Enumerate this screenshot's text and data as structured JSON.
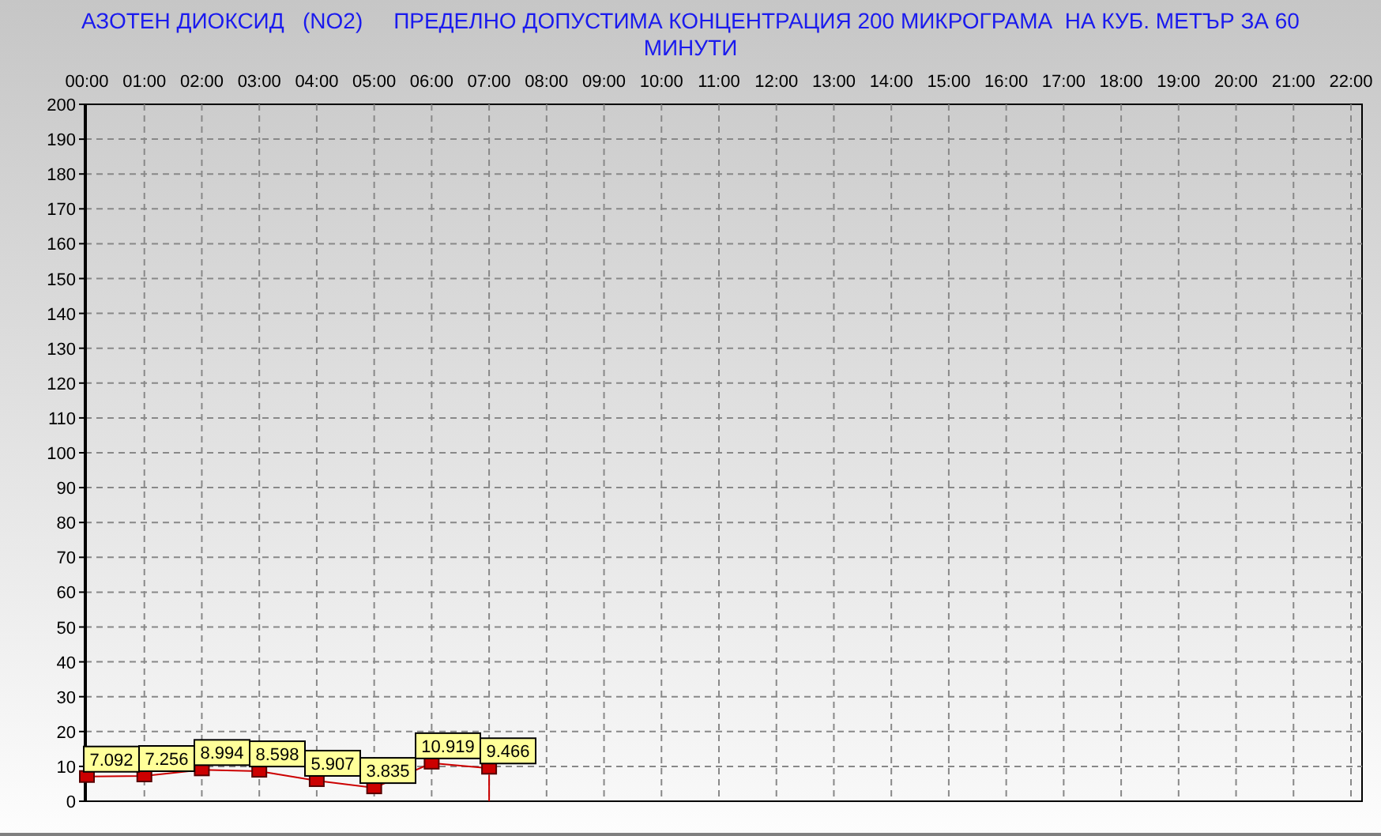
{
  "title": "АЗОТЕН ДИОКСИД   (NO2)     ПРЕДЕЛНО ДОПУСТИМА КОНЦЕНТРАЦИЯ 200 МИКРОГРАМА  НА КУБ. МЕТЪР ЗА 60 МИНУТИ",
  "chart_data": {
    "type": "line",
    "categories": [
      "00:00",
      "01:00",
      "02:00",
      "03:00",
      "04:00",
      "05:00",
      "06:00",
      "07:00",
      "08:00",
      "09:00",
      "10:00",
      "11:00",
      "12:00",
      "13:00",
      "14:00",
      "15:00",
      "16:00",
      "17:00",
      "18:00",
      "19:00",
      "20:00",
      "21:00",
      "22:00"
    ],
    "grid": true,
    "series": [
      {
        "color": "#cc0000",
        "marker": "square",
        "values": [
          7.092,
          7.256,
          8.994,
          8.598,
          5.907,
          3.835,
          10.919,
          9.466,
          null,
          null,
          null,
          null,
          null,
          null,
          null,
          null,
          null,
          null,
          null,
          null,
          null,
          null,
          null
        ]
      }
    ],
    "ylim": [
      0,
      200
    ],
    "yticks": [
      0,
      10,
      20,
      30,
      40,
      50,
      60,
      70,
      80,
      90,
      100,
      110,
      120,
      130,
      140,
      150,
      160,
      170,
      180,
      190,
      200
    ],
    "data_labels": true
  }
}
